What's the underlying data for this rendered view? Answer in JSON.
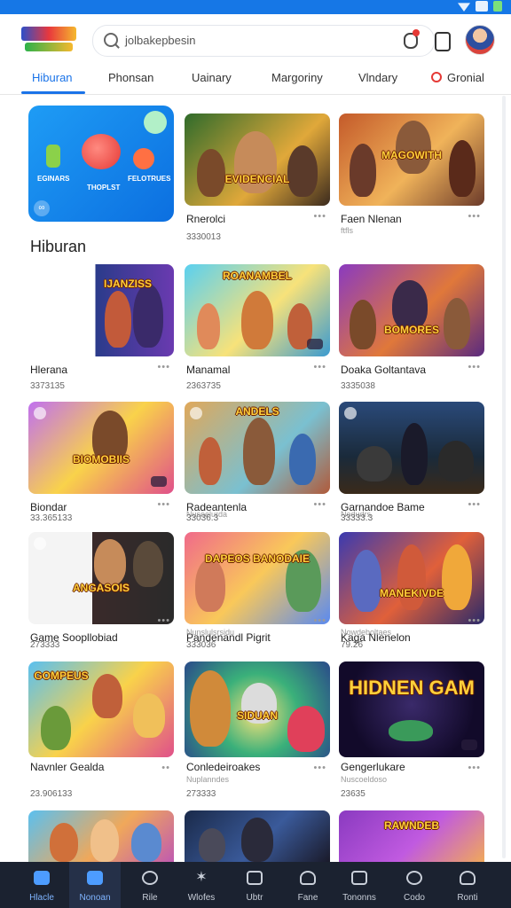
{
  "colors": {
    "accent": "#1a73e8",
    "statusbar": "#1677e6",
    "navbar": "#1b2230"
  },
  "search": {
    "query": "jolbakepbesin"
  },
  "tabs": [
    {
      "label": "Hiburan",
      "active": true
    },
    {
      "label": "Phonsan"
    },
    {
      "label": "Uainary"
    },
    {
      "label": "Margoriny"
    },
    {
      "label": "Vlndary"
    },
    {
      "label": "Gronial",
      "icon": "red-circle-icon"
    }
  ],
  "featured": {
    "label_left": "EGINARS",
    "label_mid": "THOPLST",
    "label_right": "FELOTRUES"
  },
  "section_title": "Hiburan",
  "row0": [
    {
      "thumb_text": "EVIDENCIAL",
      "name": "Rnerolci",
      "meta": "3330013"
    },
    {
      "thumb_text": "MAGOWITH",
      "name": "Faen Nlenan",
      "sub": "ftfls"
    }
  ],
  "rows": [
    [
      {
        "thumb_text": "IJANZISS",
        "name": "Hlerana",
        "meta": "3373135"
      },
      {
        "thumb_text": "ROANAMBEL",
        "name": "Manamal",
        "meta": "2363735"
      },
      {
        "thumb_text": "BOMORES",
        "name": "Doaka Goltantava",
        "meta": "3335038"
      }
    ],
    [
      {
        "thumb_text": "BIOMOBIIS",
        "name": "Biondar",
        "meta": "33.365133"
      },
      {
        "thumb_text": "ANDELS",
        "name": "Radeantenla",
        "sub": "Nusoelurda",
        "meta": "33036.3"
      },
      {
        "thumb_text": "",
        "name": "Garnandoe Bame",
        "sub": "Nodudrs",
        "meta": "33333.3"
      }
    ],
    [
      {
        "thumb_text": "ANGASOIS",
        "name": "Game Soopllobiad",
        "meta": "273333"
      },
      {
        "thumb_text": "DAPEOS BANODAIE",
        "name": "Pandenandl Pigrit",
        "sub": "Nunslulsrsidu",
        "meta": "333036"
      },
      {
        "thumb_text": "MANEKIVDE",
        "name": "Kaga Nlenelon",
        "sub": "Nowdeboltaes",
        "meta": "79.26"
      }
    ],
    [
      {
        "thumb_text": "GOMPEUS",
        "name": "Navnler Gealda",
        "meta": "23.906133"
      },
      {
        "thumb_text": "SIDUAN",
        "name": "Conledeiroakes",
        "sub": "Nuplanndes",
        "meta": "273333"
      },
      {
        "thumb_text": "HIDNEN GAM",
        "name": "Gengerlukare",
        "sub": "Nuscoeldoso",
        "meta": "23635"
      }
    ],
    [
      {
        "thumb_text": "",
        "name": "",
        "meta": ""
      },
      {
        "thumb_text": "",
        "name": "",
        "meta": ""
      },
      {
        "thumb_text": "RAWNDEB",
        "name": "",
        "meta": ""
      }
    ]
  ],
  "nav": [
    {
      "label": "Hlacle",
      "icon": "home-icon",
      "active": false
    },
    {
      "label": "Nonoan",
      "icon": "apps-icon",
      "active": true
    },
    {
      "label": "Rile",
      "icon": "clock-icon"
    },
    {
      "label": "Wlofes",
      "icon": "star-icon"
    },
    {
      "label": "Ubtr",
      "icon": "bag-icon"
    },
    {
      "label": "Fane",
      "icon": "person-icon"
    },
    {
      "label": "Tononns",
      "icon": "folder-icon"
    },
    {
      "label": "Codo",
      "icon": "search-icon"
    },
    {
      "label": "Ronti",
      "icon": "profile-icon"
    }
  ]
}
